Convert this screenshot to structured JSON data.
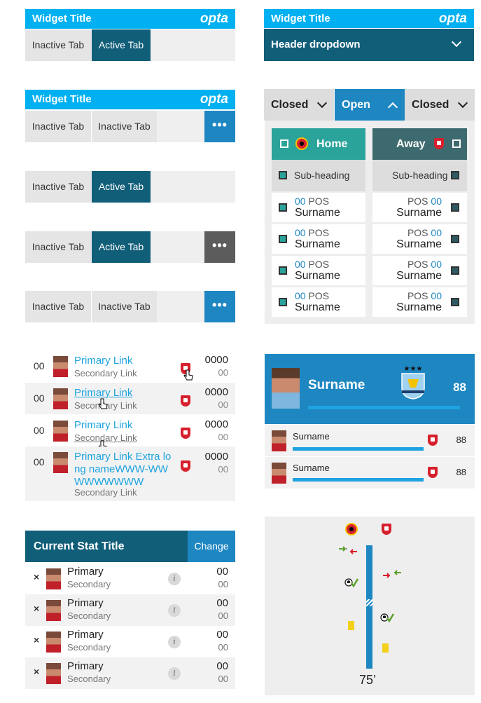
{
  "widget": {
    "title": "Widget Title",
    "brand": "opta"
  },
  "tabs": {
    "inactive": "Inactive Tab",
    "active": "Active Tab",
    "more": "•••"
  },
  "header_dropdown": {
    "label": "Header dropdown"
  },
  "dropdown_tabs": {
    "closed": "Closed",
    "open": "Open"
  },
  "lineup": {
    "home_label": "Home",
    "away_label": "Away",
    "subheading": "Sub-heading",
    "pos_num": "00",
    "pos_label": "POS",
    "surname": "Surname"
  },
  "link_list": {
    "rows": [
      {
        "index": "00",
        "primary": "Primary Link",
        "secondary": "Secondary Link",
        "value": "0000",
        "sub_value": "00"
      },
      {
        "index": "00",
        "primary": "Primary Link",
        "secondary": "Secondary Link",
        "value": "0000",
        "sub_value": "00"
      },
      {
        "index": "00",
        "primary": "Primary Link",
        "secondary": "Secondary Link",
        "value": "0000",
        "sub_value": "00"
      },
      {
        "index": "00",
        "primary": "Primary Link Extra long nameWWW-WWWWWWWWW",
        "secondary": "Secondary Link",
        "value": "0000",
        "sub_value": "00"
      }
    ]
  },
  "featured": {
    "surname": "Surname",
    "value": "88",
    "progress": 0.96,
    "rows": [
      {
        "surname": "Surname",
        "value": "88",
        "progress": 0.85
      },
      {
        "surname": "Surname",
        "value": "88",
        "progress": 0.85
      }
    ]
  },
  "stat_widget": {
    "title": "Current Stat Title",
    "change_label": "Change",
    "remove": "×",
    "info": "i",
    "rows": [
      {
        "primary": "Primary",
        "secondary": "Secondary",
        "value": "00",
        "sub_value": "00"
      },
      {
        "primary": "Primary",
        "secondary": "Secondary",
        "value": "00",
        "sub_value": "00"
      },
      {
        "primary": "Primary",
        "secondary": "Secondary",
        "value": "00",
        "sub_value": "00"
      },
      {
        "primary": "Primary",
        "secondary": "Secondary",
        "value": "00",
        "sub_value": "00"
      }
    ]
  },
  "timeline": {
    "minute": "75’"
  },
  "colors": {
    "sky": "#00b0f0",
    "teal_dark": "#115e79",
    "blue": "#1e87c2",
    "home_teal": "#2aa39a",
    "away_slate": "#3d6a6e",
    "arsenal_red": "#d6202d"
  }
}
